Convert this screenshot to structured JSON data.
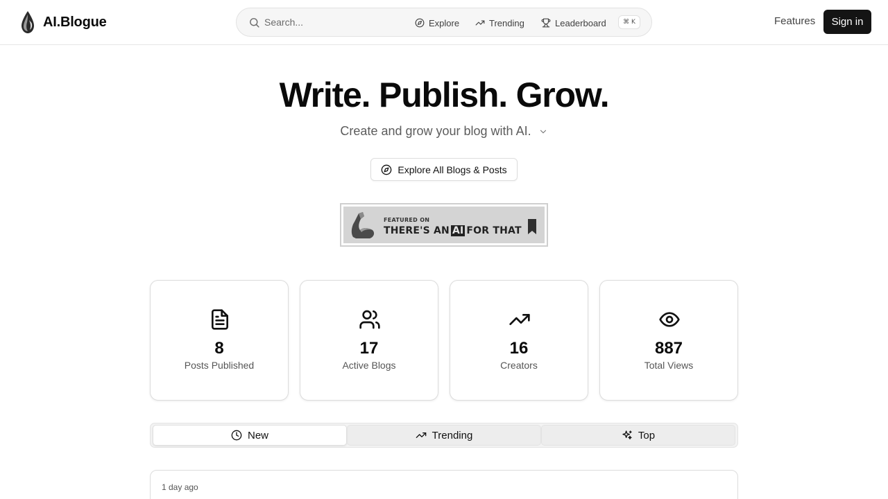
{
  "brand": {
    "name": "AI.Blogue"
  },
  "search": {
    "placeholder": "Search...",
    "nav": [
      {
        "label": "Explore",
        "icon": "compass-icon"
      },
      {
        "label": "Trending",
        "icon": "trending-up-icon"
      },
      {
        "label": "Leaderboard",
        "icon": "trophy-icon"
      }
    ],
    "shortcut": "⌘ K"
  },
  "header": {
    "features_label": "Features",
    "signin_label": "Sign in"
  },
  "hero": {
    "title": "Write. Publish. Grow.",
    "subtitle": "Create and grow your blog with AI.",
    "explore_label": "Explore All Blogs & Posts"
  },
  "featured_badge": {
    "small_text": "FEATURED ON",
    "big_text_before": "THERE'S AN",
    "big_text_ai": "AI",
    "big_text_after": "FOR THAT"
  },
  "stats": [
    {
      "icon": "document-icon",
      "value": "8",
      "label": "Posts Published"
    },
    {
      "icon": "users-icon",
      "value": "17",
      "label": "Active Blogs"
    },
    {
      "icon": "trending-up-icon",
      "value": "16",
      "label": "Creators"
    },
    {
      "icon": "eye-icon",
      "value": "887",
      "label": "Total Views"
    }
  ],
  "tabs": [
    {
      "label": "New",
      "icon": "clock-icon",
      "active": true
    },
    {
      "label": "Trending",
      "icon": "trending-up-icon",
      "active": false
    },
    {
      "label": "Top",
      "icon": "sparkles-icon",
      "active": false
    }
  ],
  "posts": [
    {
      "time": "1 day ago",
      "title": ""
    }
  ],
  "colors": {
    "primary_button": "#141414",
    "border": "#dcdcdc",
    "muted_text": "#555555"
  }
}
